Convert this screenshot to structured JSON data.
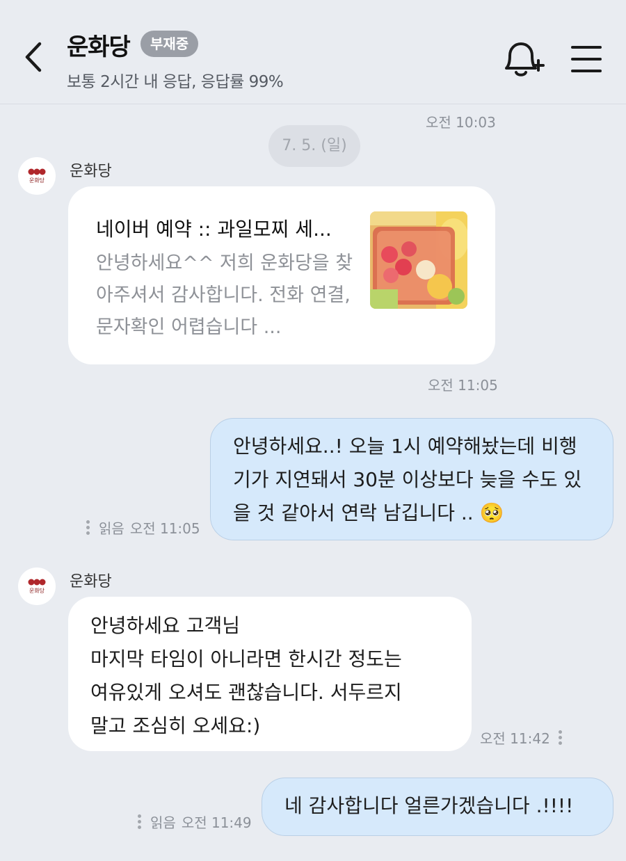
{
  "header": {
    "title": "운화당",
    "status_badge": "부재중",
    "subtitle": "보통 2시간 내 응답, 응답률 99%"
  },
  "chat": {
    "time_top": "오전 10:03",
    "date_divider": "7. 5. (일)",
    "sender_name": "운화당",
    "avatar_label": "운화당",
    "card": {
      "title": "네이버 예약 :: 과일모찌 세...",
      "body": "안녕하세요^^ 저희 운화당을 찾아주셔서 감사합니다. 전화 연결, 문자확인 어렵습니다 ...",
      "time": "오전 11:05"
    },
    "out1": {
      "text": "안녕하세요..! 오늘 1시 예약해놨는데 비행기가 지연돼서 30분 이상보다 늦을 수도 있을 것 같아서 연락 남깁니다 ..",
      "emoji": "🥺",
      "read": "읽음",
      "time": "오전 11:05"
    },
    "in2": {
      "text_lines": [
        "안녕하세요 고객님",
        "마지막 타임이 아니라면 한시간 정도는",
        "여유있게 오셔도 괜찮습니다. 서두르지",
        "말고 조심히 오세요:)"
      ],
      "time": "오전 11:42"
    },
    "out2": {
      "text": "네 감사합니다 얼른가겠습니다 .!!!!",
      "read": "읽음",
      "time": "오전 11:49"
    }
  },
  "icons": {
    "back": "chevron-left-icon",
    "bell": "bell-plus-icon",
    "menu": "hamburger-menu-icon",
    "more": "kebab-icon"
  },
  "colors": {
    "background": "#e9ecf1",
    "incoming_bubble": "#ffffff",
    "outgoing_bubble": "#d6e9fb",
    "badge": "#9a9ea6",
    "brand": "#b0272b"
  }
}
